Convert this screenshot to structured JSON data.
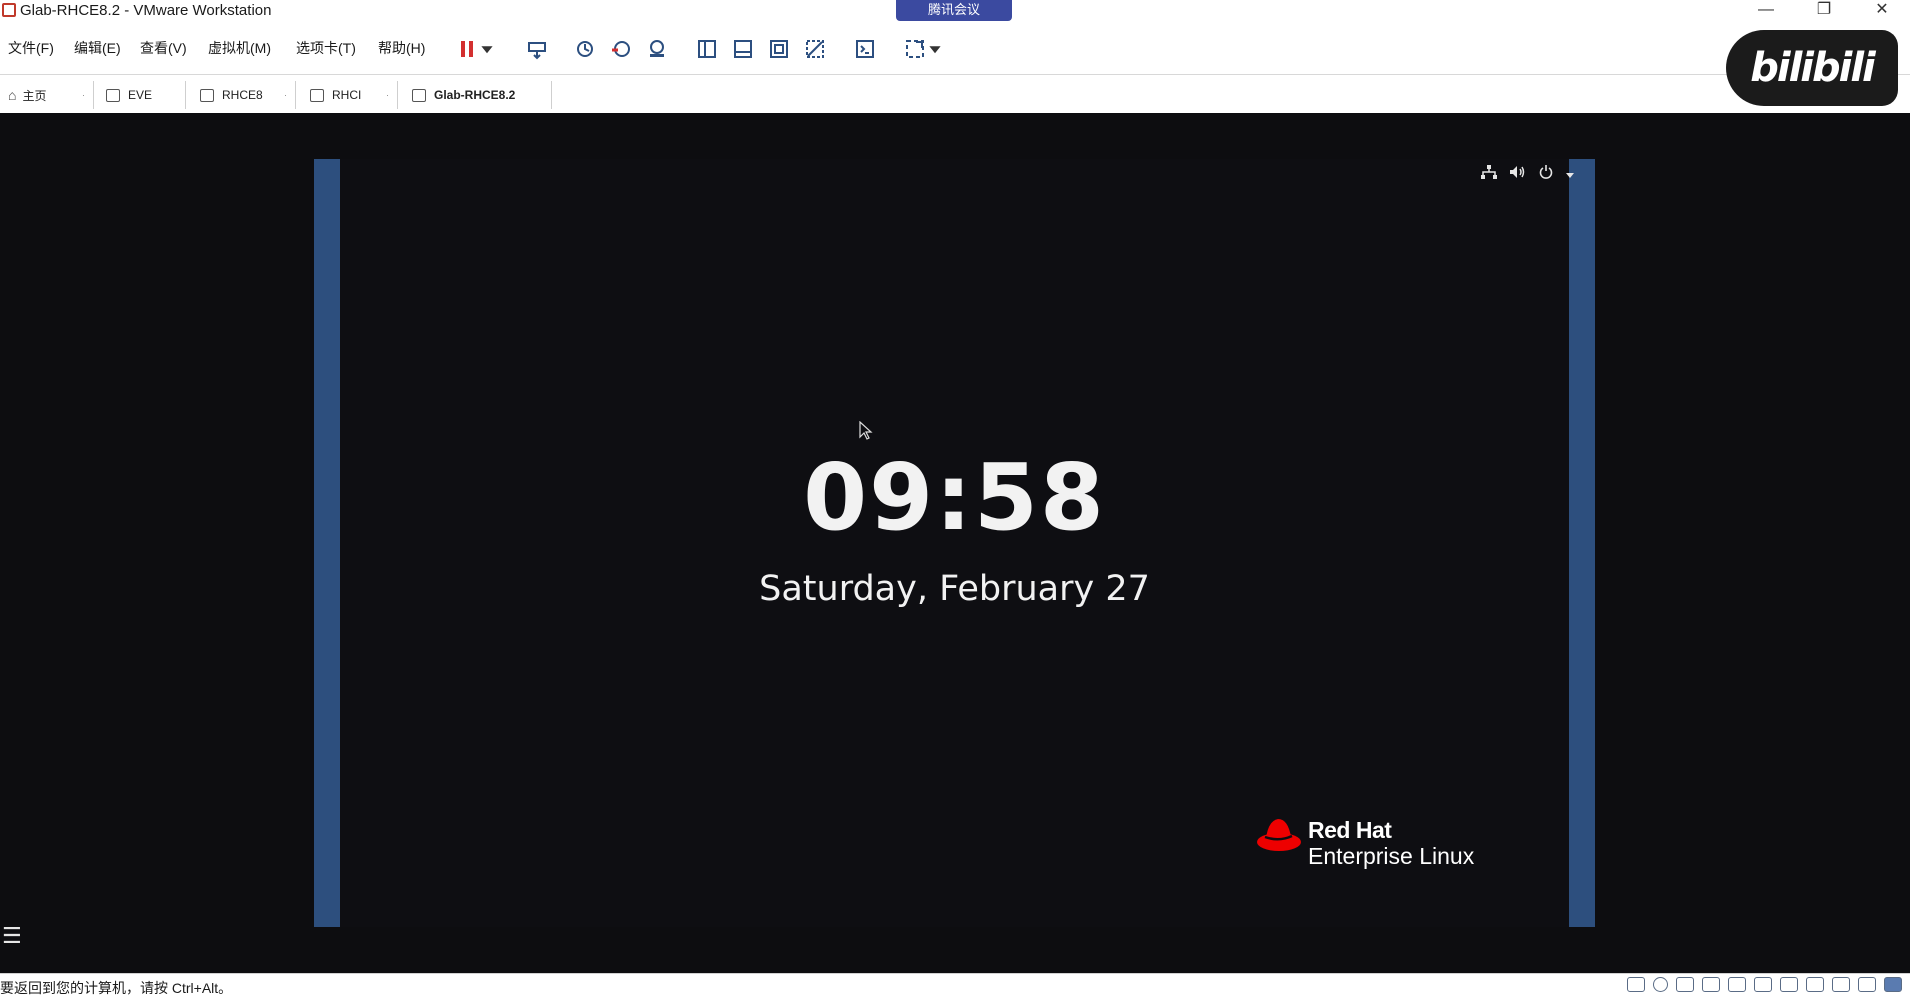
{
  "window": {
    "title": "Glab-RHCE8.2 - VMware Workstation",
    "overlay_tag": "腾讯会议",
    "minimize_icon": "minimize-icon",
    "restore_icon": "restore-icon",
    "close_icon": "close-icon"
  },
  "menu": {
    "items": [
      "文件(F)",
      "编辑(E)",
      "查看(V)",
      "虚拟机(M)",
      "选项卡(T)",
      "帮助(H)"
    ]
  },
  "toolbar": {
    "icons": [
      "pause-icon",
      "dropdown-icon",
      "send-keys-icon",
      "snapshot-icon",
      "revert-snapshot-icon",
      "snapshot-manager-icon",
      "library-icon",
      "console-view-icon",
      "fit-window-icon",
      "unity-icon",
      "terminal-icon",
      "fullscreen-icon",
      "dropdown-icon"
    ]
  },
  "tabs": [
    {
      "label": "主页",
      "active": false
    },
    {
      "label": "EVE",
      "active": false
    },
    {
      "label": "RHCE8",
      "active": false
    },
    {
      "label": "RHCI",
      "active": false
    },
    {
      "label": "Glab-RHCE8.2",
      "active": true
    }
  ],
  "watermark": {
    "text": "bilibili"
  },
  "vm": {
    "top_icons": [
      "network-icon",
      "volume-icon",
      "power-icon",
      "dropdown-icon"
    ],
    "clock": "09:58",
    "date": "Saturday, February 27",
    "logo": {
      "line1": "Red Hat",
      "line2": "Enterprise Linux",
      "hat_color": "#ee0000"
    },
    "accent_bar_color": "#2d4f7e"
  },
  "statusbar": {
    "text": "要返回到您的计算机，请按 Ctrl+Alt。"
  }
}
